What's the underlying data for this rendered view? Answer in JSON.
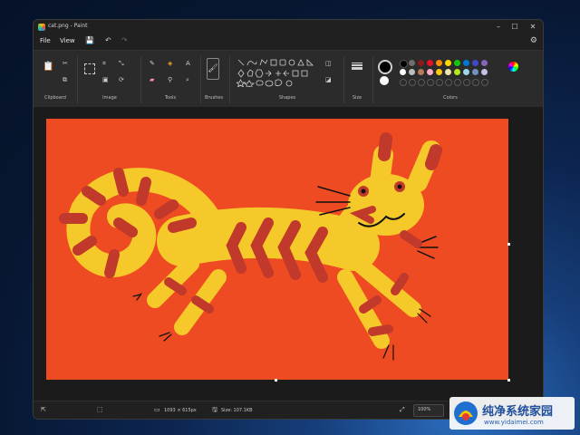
{
  "window": {
    "title": "cat.png - Paint",
    "controls": {
      "minimize": "–",
      "maximize": "☐",
      "close": "✕"
    }
  },
  "menu": {
    "file": "File",
    "view": "View"
  },
  "ribbon": {
    "groups": {
      "clipboard": "Clipboard",
      "image": "Image",
      "tools": "Tools",
      "brushes": "Brushes",
      "shapes": "Shapes",
      "size": "Size",
      "colors": "Colors"
    },
    "selected_color_primary": "#000000",
    "selected_color_secondary": "#ffffff",
    "palette_row1": [
      "#000000",
      "#6e6e6e",
      "#8b1a1a",
      "#e81123",
      "#ff8c00",
      "#ffd700",
      "#16c60c",
      "#0078d4",
      "#3f48cc",
      "#8764b8"
    ],
    "palette_row2": [
      "#ffffff",
      "#bdbdbd",
      "#b97a57",
      "#ffaec9",
      "#ffc90e",
      "#efe4b0",
      "#b5e61d",
      "#99d9ea",
      "#7092be",
      "#c8bfe7"
    ]
  },
  "canvas": {
    "background": "#ef4b22",
    "cat_body": "#f5c92a",
    "stripe": "#c0392b"
  },
  "status": {
    "dimensions": "1093 × 615px",
    "size": "Size: 107.1KB",
    "zoom": "100%"
  },
  "watermark": {
    "title": "纯净系统家园",
    "url": "www.yidaimei.com"
  }
}
